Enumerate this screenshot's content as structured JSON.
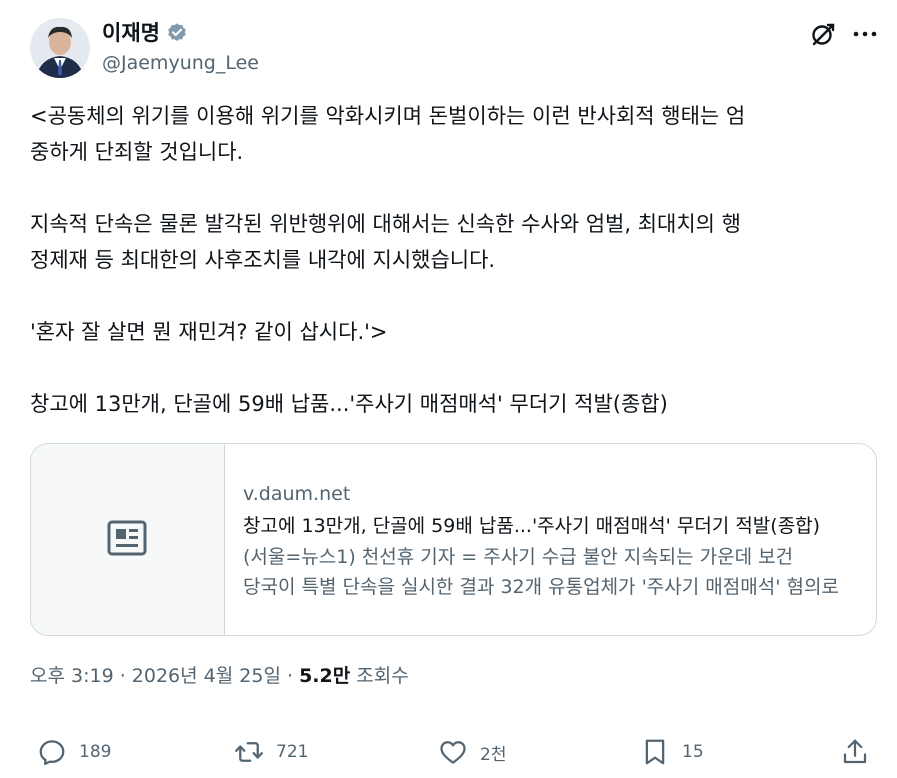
{
  "author": {
    "display_name": "이재명",
    "handle": "@Jaemyung_Lee"
  },
  "icons": {
    "verified": "verified-badge-icon",
    "grok": "grok-icon",
    "more": "more-icon",
    "article": "article-icon",
    "reply": "reply-icon",
    "retweet": "retweet-icon",
    "like": "like-icon",
    "bookmark": "bookmark-icon",
    "share": "share-icon"
  },
  "colors": {
    "text": "#0f1419",
    "secondary": "#536471",
    "border": "#cfd9de",
    "verified": "#829aab"
  },
  "tweet": {
    "lines": [
      "<공동체의 위기를 이용해 위기를 악화시키며 돈벌이하는 이런 반사회적 행태는 엄",
      "중하게 단죄할 것입니다.",
      "",
      "지속적 단속은 물론 발각된 위반행위에 대해서는 신속한 수사와 엄벌, 최대치의 행",
      "정제재 등 최대한의 사후조치를 내각에 지시했습니다.",
      "",
      "'혼자 잘 살면 뭔 재민겨? 같이 삽시다.'>",
      "",
      "창고에 13만개, 단골에 59배 납품...'주사기 매점매석' 무더기 적발(종합)"
    ]
  },
  "card": {
    "domain": "v.daum.net",
    "title": "창고에 13만개, 단골에 59배 납품...'주사기 매점매석' 무더기 적발(종합)",
    "desc_line1": "(서울=뉴스1) 천선휴 기자 = 주사기 수급 불안 지속되는 가운데 보건",
    "desc_line2": "당국이 특별 단속을 실시한 결과 32개 유통업체가 '주사기 매점매석' 혐의로"
  },
  "meta": {
    "time": "오후 3:19",
    "sep1": " · ",
    "date": "2026년 4월 25일",
    "sep2": " · ",
    "views_count": "5.2만",
    "views_label": " 조회수"
  },
  "actions": {
    "replies": "189",
    "retweets": "721",
    "likes": "2천",
    "bookmarks": "15"
  }
}
